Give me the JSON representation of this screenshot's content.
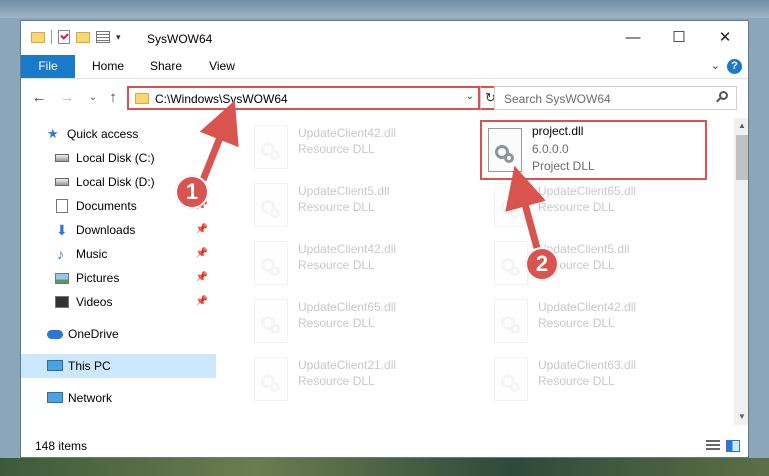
{
  "window": {
    "title": "SysWOW64",
    "controls": {
      "minimize": "—",
      "maximize": "☐",
      "close": "✕"
    }
  },
  "ribbon": {
    "tabs": [
      "File",
      "Home",
      "Share",
      "View"
    ],
    "help": "?"
  },
  "nav": {
    "address": "C:\\Windows\\SysWOW64",
    "search_placeholder": "Search SysWOW64"
  },
  "sidebar": {
    "items": [
      {
        "label": "Quick access",
        "icon": "star-icon"
      },
      {
        "label": "Local Disk (C:)",
        "icon": "drive-icon"
      },
      {
        "label": "Local Disk (D:)",
        "icon": "drive-icon"
      },
      {
        "label": "Documents",
        "icon": "documents-icon",
        "pinned": true
      },
      {
        "label": "Downloads",
        "icon": "downloads-icon",
        "pinned": true
      },
      {
        "label": "Music",
        "icon": "music-icon",
        "pinned": true
      },
      {
        "label": "Pictures",
        "icon": "pictures-icon",
        "pinned": true
      },
      {
        "label": "Videos",
        "icon": "videos-icon",
        "pinned": true
      },
      {
        "label": "OneDrive",
        "icon": "onedrive-icon"
      },
      {
        "label": "This PC",
        "icon": "pc-icon",
        "selected": true
      },
      {
        "label": "Network",
        "icon": "network-icon"
      }
    ]
  },
  "files": {
    "left": [
      {
        "name": "UpdateClient42.dll",
        "desc": "Resource DLL"
      },
      {
        "name": "UpdateClient5.dll",
        "desc": "Resource DLL"
      },
      {
        "name": "UpdateClient42.dll",
        "desc": "Resource DLL"
      },
      {
        "name": "UpdateClient65.dll",
        "desc": "Resource DLL"
      },
      {
        "name": "UpdateClient21.dll",
        "desc": "Resource DLL"
      }
    ],
    "right": [
      {
        "name": "project.dll",
        "version": "6.0.0.0",
        "desc": "Project DLL",
        "highlighted": true
      },
      {
        "name": "UpdateClient65.dll",
        "desc": "Resource DLL"
      },
      {
        "name": "UpdateClient5.dll",
        "desc": "Resource DLL"
      },
      {
        "name": "UpdateClient42.dll",
        "desc": "Resource DLL"
      },
      {
        "name": "UpdateClient63.dll",
        "desc": "Resource DLL"
      }
    ]
  },
  "status": {
    "item_count": "148 items"
  },
  "callouts": {
    "one": "1",
    "two": "2"
  },
  "colors": {
    "accent": "#1979ca",
    "highlight": "#d9534f"
  }
}
